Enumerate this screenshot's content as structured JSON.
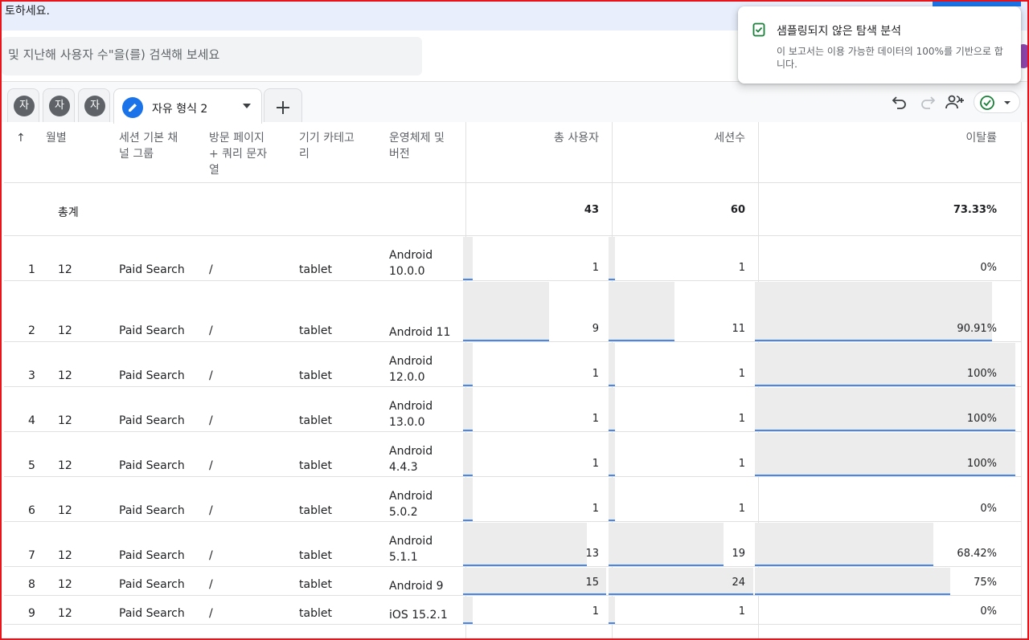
{
  "banner": {
    "text": "토하세요."
  },
  "search": {
    "placeholder": "및 지난해 사용자 수\"을(를) 검색해 보세요"
  },
  "tabs": {
    "chips": [
      {
        "avatar": "자"
      },
      {
        "avatar": "자"
      },
      {
        "avatar": "자"
      }
    ],
    "active_label": "자유 형식 2",
    "add_symbol": "+"
  },
  "toast": {
    "title": "샘플링되지 않은 탐색 분석",
    "body": "이 보고서는 이용 가능한 데이터의 100%를 기반으로 합니다."
  },
  "table": {
    "sort_symbol": "↑",
    "headers": {
      "month": "월별",
      "channel": "세션 기본 채널 그룹",
      "page": "방문 페이지 + 쿼리 문자열",
      "device": "기기 카테고리",
      "os": "운영체제 및 버전",
      "users": "총 사용자",
      "sessions": "세션수",
      "bounce": "이탈률"
    },
    "totals": {
      "label": "총계",
      "users": "43",
      "sessions": "60",
      "bounce": "73.33%"
    },
    "rows": [
      {
        "idx": "1",
        "month": "12",
        "channel": "Paid Search",
        "page": "/",
        "device": "tablet",
        "os": "Android 10.0.0",
        "users": "1",
        "sessions": "1",
        "bounce": "0%",
        "users_frac": 0.067,
        "sessions_frac": 0.042,
        "bounce_frac": 0
      },
      {
        "idx": "2",
        "month": "12",
        "channel": "Paid Search",
        "page": "/",
        "device": "tablet",
        "os": "Android 11",
        "users": "9",
        "sessions": "11",
        "bounce": "90.91%",
        "users_frac": 0.6,
        "sessions_frac": 0.458,
        "bounce_frac": 0.909
      },
      {
        "idx": "3",
        "month": "12",
        "channel": "Paid Search",
        "page": "/",
        "device": "tablet",
        "os": "Android 12.0.0",
        "users": "1",
        "sessions": "1",
        "bounce": "100%",
        "users_frac": 0.067,
        "sessions_frac": 0.042,
        "bounce_frac": 1
      },
      {
        "idx": "4",
        "month": "12",
        "channel": "Paid Search",
        "page": "/",
        "device": "tablet",
        "os": "Android 13.0.0",
        "users": "1",
        "sessions": "1",
        "bounce": "100%",
        "users_frac": 0.067,
        "sessions_frac": 0.042,
        "bounce_frac": 1
      },
      {
        "idx": "5",
        "month": "12",
        "channel": "Paid Search",
        "page": "/",
        "device": "tablet",
        "os": "Android 4.4.3",
        "users": "1",
        "sessions": "1",
        "bounce": "100%",
        "users_frac": 0.067,
        "sessions_frac": 0.042,
        "bounce_frac": 1
      },
      {
        "idx": "6",
        "month": "12",
        "channel": "Paid Search",
        "page": "/",
        "device": "tablet",
        "os": "Android 5.0.2",
        "users": "1",
        "sessions": "1",
        "bounce": "0%",
        "users_frac": 0.067,
        "sessions_frac": 0.042,
        "bounce_frac": 0
      },
      {
        "idx": "7",
        "month": "12",
        "channel": "Paid Search",
        "page": "/",
        "device": "tablet",
        "os": "Android 5.1.1",
        "users": "13",
        "sessions": "19",
        "bounce": "68.42%",
        "users_frac": 0.867,
        "sessions_frac": 0.792,
        "bounce_frac": 0.684
      },
      {
        "idx": "8",
        "month": "12",
        "channel": "Paid Search",
        "page": "/",
        "device": "tablet",
        "os": "Android 9",
        "users": "15",
        "sessions": "24",
        "bounce": "75%",
        "users_frac": 1,
        "sessions_frac": 1,
        "bounce_frac": 0.75
      },
      {
        "idx": "9",
        "month": "12",
        "channel": "Paid Search",
        "page": "/",
        "device": "tablet",
        "os": "iOS 15.2.1",
        "users": "1",
        "sessions": "1",
        "bounce": "0%",
        "users_frac": 0.067,
        "sessions_frac": 0.042,
        "bounce_frac": 0
      }
    ]
  },
  "colors": {
    "accent": "#1a73e8",
    "bar_fill": "#ececec",
    "bar_line": "#4a86e8",
    "frame": "#e8141b",
    "banner": "#e8eefb"
  },
  "icons": [
    "avatar-chip",
    "pencil-icon",
    "caret-down-icon",
    "plus-icon",
    "undo-icon",
    "redo-icon",
    "share-user-icon",
    "check-circle-icon",
    "check-doc-icon"
  ]
}
